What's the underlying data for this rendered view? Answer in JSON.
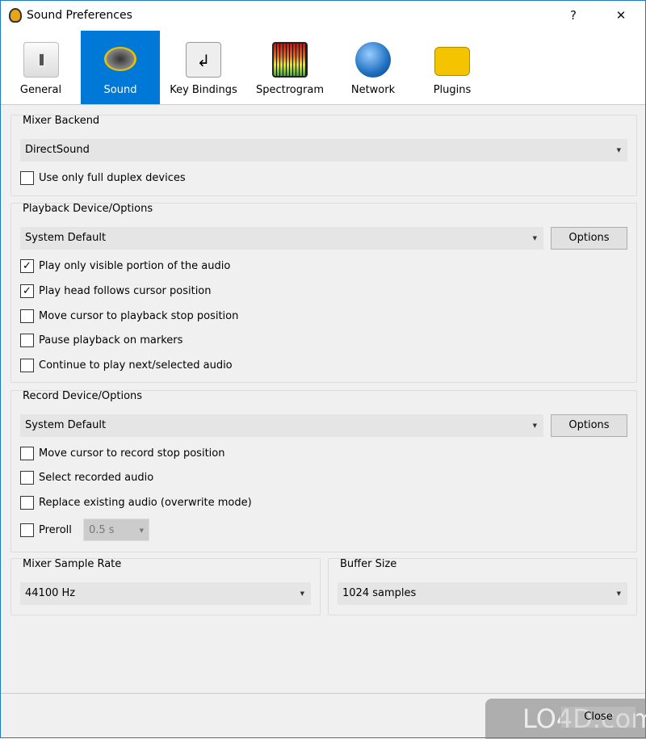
{
  "window": {
    "title": "Sound Preferences",
    "help": "?",
    "close": "✕"
  },
  "tabs": [
    {
      "label": "General",
      "icon": "toggle-switch-icon"
    },
    {
      "label": "Sound",
      "icon": "speaker-icon",
      "active": true
    },
    {
      "label": "Key Bindings",
      "icon": "enter-key-icon"
    },
    {
      "label": "Spectrogram",
      "icon": "spectrogram-icon"
    },
    {
      "label": "Network",
      "icon": "globe-icon"
    },
    {
      "label": "Plugins",
      "icon": "lego-brick-icon"
    }
  ],
  "mixer_backend": {
    "label": "Mixer Backend",
    "value": "DirectSound",
    "full_duplex": {
      "label": "Use only full duplex devices",
      "checked": false
    }
  },
  "playback": {
    "label": "Playback Device/Options",
    "device": "System Default",
    "options": "Options",
    "checks": [
      {
        "label": "Play only visible portion of the audio",
        "checked": true
      },
      {
        "label": "Play head follows cursor position",
        "checked": true
      },
      {
        "label": "Move cursor to playback stop position",
        "checked": false
      },
      {
        "label": "Pause playback on markers",
        "checked": false
      },
      {
        "label": "Continue to play next/selected audio",
        "checked": false
      }
    ]
  },
  "record": {
    "label": "Record Device/Options",
    "device": "System Default",
    "options": "Options",
    "checks": [
      {
        "label": "Move cursor to record stop position",
        "checked": false
      },
      {
        "label": "Select recorded audio",
        "checked": false
      },
      {
        "label": "Replace existing audio (overwrite mode)",
        "checked": false
      },
      {
        "label": "Preroll",
        "checked": false
      }
    ],
    "preroll_value": "0.5 s"
  },
  "sample_rate": {
    "label": "Mixer Sample Rate",
    "value": "44100 Hz"
  },
  "buffer_size": {
    "label": "Buffer Size",
    "value": "1024 samples"
  },
  "footer": {
    "close": "Close"
  },
  "watermark": "LO4D.com",
  "colors": {
    "accent": "#0078d7"
  }
}
